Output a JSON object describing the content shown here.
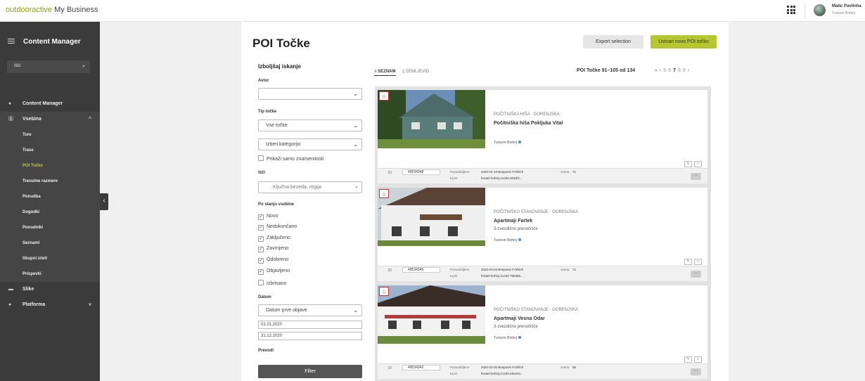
{
  "topbar": {
    "brand_part1": "outdooractive",
    "brand_part2": "My Business",
    "user_name": "Matic Pavlinha",
    "user_org": "Turizem Bohinj"
  },
  "sidebar": {
    "title": "Content Manager",
    "search_text": "Išči",
    "main_item": "Content Manager",
    "vsebina_label": "Vsebina",
    "sub_items": [
      "Ture",
      "Trase",
      "POI Točke",
      "Trenutne razmere",
      "Ponudba",
      "Dogodki",
      "Ponudniki",
      "Seznami",
      "Skupni izleti",
      "Prispevki"
    ],
    "active_sub": "POI Točke",
    "slike_label": "Slike",
    "platforma_label": "Platforma"
  },
  "page": {
    "title": "POI Točke",
    "export_label": "Export selection",
    "create_label": "Ustvari novo POI točko"
  },
  "filters": {
    "title": "Izboljšaj iskanje",
    "avtor_label": "Avtor",
    "avtor_value": "",
    "tip_label": "Tip točke",
    "tip_value": "Vse točke",
    "kategorija_value": "Izberi kategorijo",
    "znamenitosti_label": "Prikaži samo znamenitosti",
    "isci_label": "Išči",
    "isci_placeholder": "Ključna beseda, regija",
    "stanje_label": "Po stanju vsebine",
    "stanje": [
      {
        "label": "Novo",
        "checked": true
      },
      {
        "label": "Nedokončano",
        "checked": true
      },
      {
        "label": "Zaključeno",
        "checked": true
      },
      {
        "label": "Zavrnjeno",
        "checked": true
      },
      {
        "label": "Odobreno",
        "checked": true
      },
      {
        "label": "Objavljeno",
        "checked": true
      },
      {
        "label": "Izbrisano",
        "checked": false
      }
    ],
    "datum_label": "Datum",
    "datum_type": "Datum prve objave",
    "date_from": "01.01.2020",
    "date_to": "31.12.2020",
    "prevodi_label": "Prevodi",
    "filter_button": "Filter"
  },
  "results": {
    "tab_list": "SEZNAM",
    "tab_map": "ZEMLJEVID",
    "count_text": "POI Točke 91–105 od 134",
    "pager": [
      "«",
      "‹",
      "5",
      "6",
      "7",
      "8",
      "9",
      "›"
    ],
    "current_page": "7"
  },
  "cards": [
    {
      "category": "POČITNIŠKA HIŠA · GORENJSKA",
      "name": "Počitniška hiša Pokljuka Vital",
      "desc": "",
      "org": "Turizem Bohinj",
      "id": "49534348",
      "posodobljeno_label": "Posodobljeno",
      "posodobljeno_value": "2020-02-18 Benjamin Fröhlich",
      "tuj_label": "tuj ID",
      "tuj_value": "feratel-bohinj.21430.eb33f4...",
      "ocena_label": "ocena",
      "ocena_value": "71"
    },
    {
      "category": "POČITNIŠKO STANOVANJE · GORENJSKA",
      "name": "Apartmaji Fartek",
      "desc": "3-zvezdično prenočišče",
      "org": "Turizem Bohinj",
      "id": "49534349",
      "posodobljeno_label": "Posodobljeno",
      "posodobljeno_value": "2020-03-03 Benjamin Fröhlich",
      "tuj_label": "tuj ID",
      "tuj_value": "feratel-bohinj.21430.75bd69...",
      "ocena_label": "ocena",
      "ocena_value": "71"
    },
    {
      "category": "POČITNIŠKO STANOVANJE · GORENJSKA",
      "name": "Apartmaji Vesna Odar",
      "desc": "3-zvezdično prenočišče",
      "org": "Turizem Bohinj",
      "id": "49534342",
      "posodobljeno_label": "Posodobljeno",
      "posodobljeno_value": "2020-03-25 Benjamin Fröhlich",
      "tuj_label": "tuj ID",
      "tuj_value": "feratel-bohinj.21430.e5e204...",
      "ocena_label": "ocena",
      "ocena_value": "66"
    }
  ],
  "colors": {
    "brand_green": "#8aa317",
    "accent_lime": "#b5c72e",
    "sidebar_bg": "#3b3b3b"
  }
}
